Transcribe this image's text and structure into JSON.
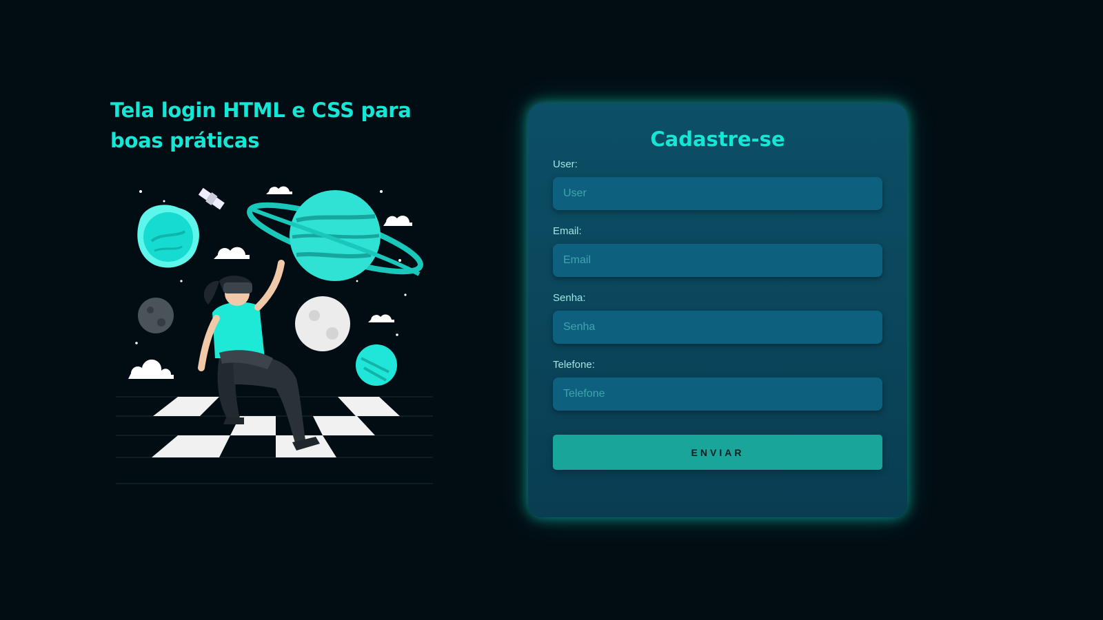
{
  "hero": {
    "title": "Tela login HTML e CSS para boas práticas"
  },
  "form": {
    "title": "Cadastre-se",
    "fields": [
      {
        "label": "User:",
        "placeholder": "User"
      },
      {
        "label": "Email:",
        "placeholder": "Email"
      },
      {
        "label": "Senha:",
        "placeholder": "Senha"
      },
      {
        "label": "Telefone:",
        "placeholder": "Telefone"
      }
    ],
    "submit_label": "ENVIAR"
  },
  "colors": {
    "background": "#020d13",
    "accent": "#16e6d6",
    "card": "#0c4f66",
    "input": "#0e617e",
    "button": "#1aa59a"
  },
  "icons": {
    "illustration": "vr-space-dancer-illustration"
  }
}
